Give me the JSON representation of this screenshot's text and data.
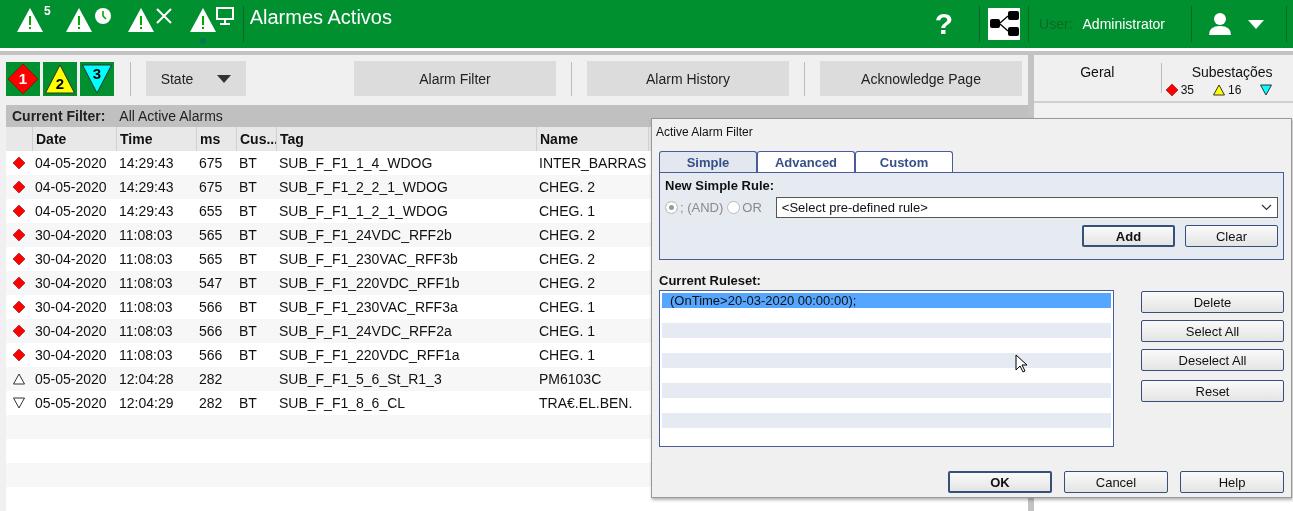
{
  "header": {
    "alarm_count": "5",
    "title": "Alarmes Activos",
    "help": "?",
    "user_label": "User:",
    "user_name": "Administrator"
  },
  "severity_buttons": [
    {
      "label": "1",
      "kind": "diamond",
      "color": "#ff0000"
    },
    {
      "label": "2",
      "kind": "triangle-up",
      "color": "#ffff00"
    },
    {
      "label": "3",
      "kind": "triangle-down",
      "color": "#00ffff"
    }
  ],
  "toolbar": {
    "state_dropdown": "State",
    "buttons": [
      "Alarm Filter",
      "Alarm History",
      "Acknowledge Page"
    ]
  },
  "filter_bar": {
    "label": "Current Filter:",
    "value": "All Active Alarms"
  },
  "table": {
    "columns": [
      "Date",
      "Time",
      "ms",
      "Cus...",
      "Tag",
      "Name"
    ],
    "rows": [
      {
        "kind": "diamond",
        "cells": [
          "04-05-2020",
          "14:29:43",
          "675",
          "BT",
          "SUB_F_F1_1_4_WDOG",
          "INTER_BARRAS"
        ]
      },
      {
        "kind": "diamond",
        "cells": [
          "04-05-2020",
          "14:29:43",
          "675",
          "BT",
          "SUB_F_F1_2_2_1_WDOG",
          "CHEG. 2"
        ]
      },
      {
        "kind": "diamond",
        "cells": [
          "04-05-2020",
          "14:29:43",
          "655",
          "BT",
          "SUB_F_F1_1_2_1_WDOG",
          "CHEG. 1"
        ]
      },
      {
        "kind": "diamond",
        "cells": [
          "30-04-2020",
          "11:08:03",
          "565",
          "BT",
          "SUB_F_F1_24VDC_RFF2b",
          "CHEG. 2"
        ]
      },
      {
        "kind": "diamond",
        "cells": [
          "30-04-2020",
          "11:08:03",
          "565",
          "BT",
          "SUB_F_F1_230VAC_RFF3b",
          "CHEG. 2"
        ]
      },
      {
        "kind": "diamond",
        "cells": [
          "30-04-2020",
          "11:08:03",
          "547",
          "BT",
          "SUB_F_F1_220VDC_RFF1b",
          "CHEG. 2"
        ]
      },
      {
        "kind": "diamond",
        "cells": [
          "30-04-2020",
          "11:08:03",
          "566",
          "BT",
          "SUB_F_F1_230VAC_RFF3a",
          "CHEG. 1"
        ]
      },
      {
        "kind": "diamond",
        "cells": [
          "30-04-2020",
          "11:08:03",
          "566",
          "BT",
          "SUB_F_F1_24VDC_RFF2a",
          "CHEG. 1"
        ]
      },
      {
        "kind": "diamond",
        "cells": [
          "30-04-2020",
          "11:08:03",
          "566",
          "BT",
          "SUB_F_F1_220VDC_RFF1a",
          "CHEG. 1"
        ]
      },
      {
        "kind": "triangle-up",
        "cells": [
          "05-05-2020",
          "12:04:28",
          "282",
          "",
          "SUB_F_F1_5_6_St_R1_3",
          "PM6103C"
        ]
      },
      {
        "kind": "triangle-down",
        "cells": [
          "05-05-2020",
          "12:04:29",
          "282",
          "BT",
          "SUB_F_F1_8_6_CL",
          "TRA€.EL.BEN."
        ]
      }
    ]
  },
  "side_panel": {
    "tabs": [
      {
        "label": "Geral"
      },
      {
        "label": "Subestações"
      }
    ],
    "counts": [
      {
        "kind": "diamond",
        "color": "#ff0000",
        "value": "35"
      },
      {
        "kind": "triangle-up",
        "color": "#ffff00",
        "value": "16"
      },
      {
        "kind": "triangle-down",
        "color": "#00ffff"
      }
    ]
  },
  "dialog": {
    "title": "Active Alarm Filter",
    "tabs": [
      {
        "label": "Simple",
        "selected": true
      },
      {
        "label": "Advanced",
        "selected": false
      },
      {
        "label": "Custom",
        "selected": false
      }
    ],
    "new_rule_label": "New Simple Rule:",
    "operators": [
      {
        "label": "; (AND)",
        "selected": true,
        "disabled": true
      },
      {
        "label": "OR",
        "selected": false,
        "disabled": true
      }
    ],
    "rule_select": "<Select pre-defined rule>",
    "rule_buttons": [
      "Add",
      "Clear"
    ],
    "ruleset_label": "Current Ruleset:",
    "ruleset": [
      {
        "text": "(OnTime>20-03-2020 00:00:00);",
        "selected": true
      }
    ],
    "list_buttons": [
      "Delete",
      "Select All",
      "Deselect All",
      "Reset"
    ],
    "footer_buttons": [
      {
        "label": "OK",
        "default": true
      },
      {
        "label": "Cancel",
        "default": false
      },
      {
        "label": "Help",
        "default": false
      }
    ]
  }
}
